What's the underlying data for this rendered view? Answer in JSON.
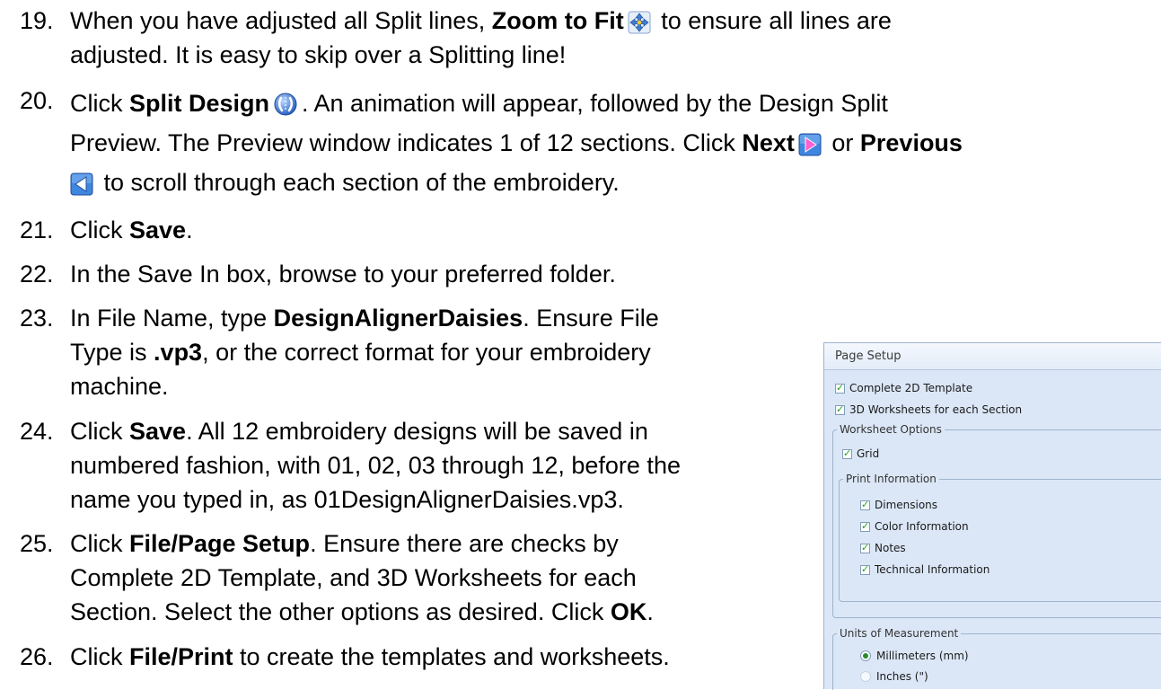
{
  "steps": [
    {
      "number": "19.",
      "segments": [
        "When you have adjusted all Split lines, ",
        "Zoom to Fit",
        " to ensure all lines are",
        "adjusted.  It is easy to skip over a Splitting line!"
      ],
      "icon": "zoom-to-fit-icon"
    },
    {
      "number": "20.",
      "segments": [
        "Click ",
        "Split Design",
        ".  An animation will appear, followed by the Design Split",
        "Preview.  The Preview window indicates 1 of 12 sections.  Click ",
        "Next",
        " or ",
        "Previous",
        " to scroll through each section of the embroidery."
      ],
      "icons": [
        "split-design-icon",
        "next-arrow-icon",
        "previous-arrow-icon"
      ]
    },
    {
      "number": "21.",
      "segments": [
        "Click ",
        "Save",
        "."
      ]
    },
    {
      "number": "22.",
      "segments": [
        "In the Save In box, browse to your preferred folder."
      ]
    },
    {
      "number": "23.",
      "segments": [
        "In File Name, type ",
        "DesignAlignerDaisies",
        ".  Ensure File",
        "Type is ",
        ".vp3",
        ", or the correct format for your embroidery",
        "machine."
      ]
    },
    {
      "number": "24.",
      "segments": [
        "Click ",
        "Save",
        ".  All 12 embroidery designs will be saved in",
        "numbered fashion, with 01, 02, 03 through 12, before the",
        "name you typed in, as 01DesignAlignerDaisies.vp3."
      ]
    },
    {
      "number": "25.",
      "segments": [
        "Click ",
        "File/Page Setup",
        ".  Ensure there are checks by",
        "Complete 2D Template, and 3D Worksheets for each",
        "Section.  Select the other options as desired.  Click ",
        "OK",
        "."
      ]
    },
    {
      "number": "26.",
      "segments": [
        "Click ",
        "File/Print",
        " to create the templates and worksheets."
      ]
    }
  ],
  "page_setup": {
    "title": "Page Setup",
    "complete_2d": {
      "label": "Complete 2D Template",
      "checked": true
    },
    "worksheets_3d": {
      "label": "3D Worksheets for each Section",
      "checked": true
    },
    "worksheet_options": {
      "legend": "Worksheet Options",
      "grid": {
        "label": "Grid",
        "checked": true
      },
      "print_information": {
        "legend": "Print Information",
        "dimensions": {
          "label": "Dimensions",
          "checked": true
        },
        "color_information": {
          "label": "Color Information",
          "checked": true
        },
        "notes": {
          "label": "Notes",
          "checked": true
        },
        "technical_information": {
          "label": "Technical Information",
          "checked": true
        }
      }
    },
    "units": {
      "legend": "Units of Measurement",
      "millimeters": {
        "label": "Millimeters (mm)",
        "selected": true
      },
      "inches": {
        "label": "Inches (\")",
        "selected": false
      }
    }
  }
}
